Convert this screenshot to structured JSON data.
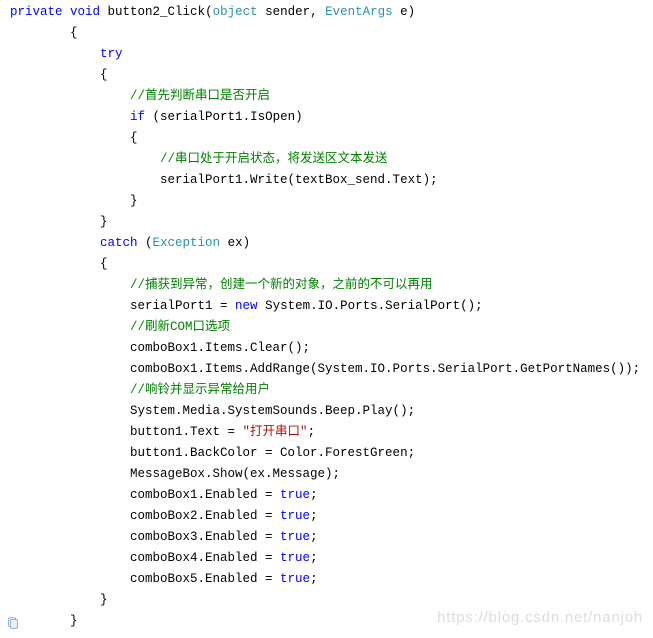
{
  "code": {
    "l1_kw_private": "private",
    "l1_kw_void": "void",
    "l1_name": " button2_Click(",
    "l1_pt_object": "object",
    "l1_mid": " sender, ",
    "l1_pt_eventargs": "EventArgs",
    "l1_end": " e)",
    "l2": "        {",
    "l3_pad": "            ",
    "l3_kw": "try",
    "l4": "            {",
    "l5_pad": "                ",
    "l5_c": "//首先判断串口是否开启",
    "l6_pad": "                ",
    "l6_kw": "if",
    "l6_rest": " (serialPort1.IsOpen)",
    "l7": "                {",
    "l8_pad": "                    ",
    "l8_c": "//串口处于开启状态，将发送区文本发送",
    "l9": "                    serialPort1.Write(textBox_send.Text);",
    "l10": "                }",
    "l11": "            }",
    "l12_pad": "            ",
    "l12_kw": "catch",
    "l12_mid": " (",
    "l12_pt": "Exception",
    "l12_end": " ex)",
    "l13": "            {",
    "l14_pad": "                ",
    "l14_c": "//捕获到异常，创建一个新的对象，之前的不可以再用",
    "l15_pad": "                serialPort1 = ",
    "l15_kw": "new",
    "l15_rest": " System.IO.Ports.SerialPort();",
    "l16_pad": "                ",
    "l16_c": "//刷新COM口选项",
    "l17": "                comboBox1.Items.Clear();",
    "l18": "                comboBox1.Items.AddRange(System.IO.Ports.SerialPort.GetPortNames());",
    "l19_pad": "                ",
    "l19_c": "//响铃并显示异常给用户",
    "l20": "                System.Media.SystemSounds.Beep.Play();",
    "l21_pad": "                button1.Text = ",
    "l21_str": "\"打开串口\"",
    "l21_end": ";",
    "l22": "                button1.BackColor = Color.ForestGreen;",
    "l23": "                MessageBox.Show(ex.Message);",
    "l24_pad": "                comboBox1.Enabled = ",
    "l24_kw": "true",
    "l24_end": ";",
    "l25_pad": "                comboBox2.Enabled = ",
    "l25_kw": "true",
    "l25_end": ";",
    "l26_pad": "                comboBox3.Enabled = ",
    "l26_kw": "true",
    "l26_end": ";",
    "l27_pad": "                comboBox4.Enabled = ",
    "l27_kw": "true",
    "l27_end": ";",
    "l28_pad": "                comboBox5.Enabled = ",
    "l28_kw": "true",
    "l28_end": ";",
    "l29": "            }",
    "l30": "        }"
  },
  "watermark": "https://blog.csdn.net/nanjoh"
}
